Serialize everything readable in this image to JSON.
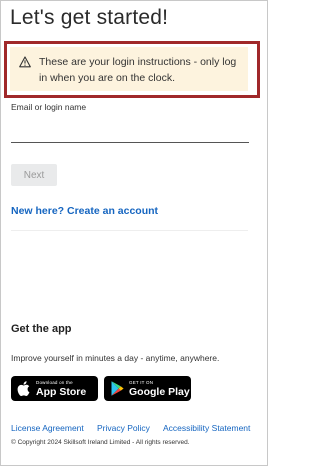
{
  "page": {
    "title": "Let's get started!"
  },
  "alert": {
    "icon": "warning-triangle-icon",
    "text": "These are your login instructions - only log in when you are on the clock.",
    "highlight_color": "#a0282a",
    "background_color": "#fdf3de"
  },
  "login": {
    "field_label": "Email or login name",
    "field_value": "",
    "next_label": "Next",
    "create_account_label": "New here? Create an account"
  },
  "app_promo": {
    "heading": "Get the app",
    "subtext": "Improve yourself in minutes a day - anytime, anywhere.",
    "app_store": {
      "icon": "apple-icon",
      "small_text": "Download on the",
      "big_text": "App Store"
    },
    "google_play": {
      "icon": "google-play-icon",
      "small_text": "GET IT ON",
      "big_text": "Google Play"
    }
  },
  "footer": {
    "links": [
      "License Agreement",
      "Privacy Policy",
      "Accessibility Statement"
    ],
    "copyright": "© Copyright 2024 Skillsoft Ireland Limited - All rights reserved."
  },
  "colors": {
    "link": "#1565c0",
    "disabled_button": "#e9eaeb"
  }
}
